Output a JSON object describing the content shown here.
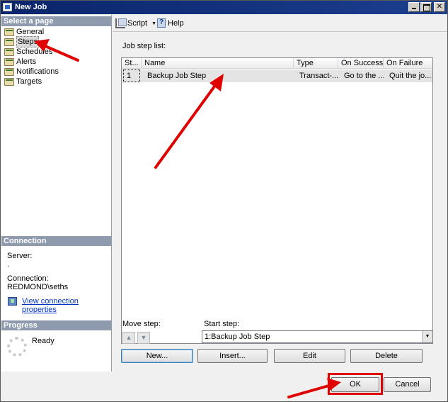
{
  "window": {
    "title": "New Job"
  },
  "left_panel": {
    "select_page_header": "Select a page",
    "pages": [
      {
        "label": "General"
      },
      {
        "label": "Steps",
        "selected": true
      },
      {
        "label": "Schedules"
      },
      {
        "label": "Alerts"
      },
      {
        "label": "Notifications"
      },
      {
        "label": "Targets"
      }
    ],
    "connection": {
      "header": "Connection",
      "server_label": "Server:",
      "server_value": ".",
      "connection_label": "Connection:",
      "connection_value": "REDMOND\\seths",
      "view_properties_link": "View connection properties"
    },
    "progress": {
      "header": "Progress",
      "status": "Ready"
    }
  },
  "toolbar": {
    "script_label": "Script",
    "help_label": "Help"
  },
  "main": {
    "job_step_list_label": "Job step list:",
    "columns": [
      "St...",
      "Name",
      "Type",
      "On Success",
      "On Failure"
    ],
    "rows": [
      [
        "1",
        "Backup Job Step",
        "Transact-...",
        "Go to the ...",
        "Quit the jo..."
      ]
    ],
    "move_step_label": "Move step:",
    "move_up_glyph": "▲",
    "move_down_glyph": "▼",
    "start_step_label": "Start step:",
    "start_step_value": "1:Backup Job Step",
    "buttons": {
      "new": "New...",
      "insert": "Insert...",
      "edit": "Edit",
      "delete": "Delete"
    }
  },
  "footer": {
    "ok": "OK",
    "cancel": "Cancel"
  },
  "annotation_color": "#e00000"
}
